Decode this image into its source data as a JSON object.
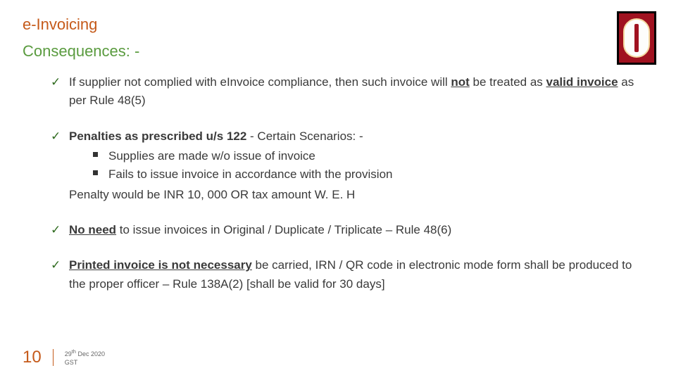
{
  "header": {
    "title": "e-Invoicing",
    "subtitle": "Consequences: -"
  },
  "points": {
    "p1": {
      "pre": "If supplier not complied with eInvoice compliance, then such invoice will ",
      "not": "not",
      "mid": " be treated as ",
      "valid": "valid invoice",
      "post": " as per Rule 48(5)"
    },
    "p2": {
      "lead_bold": "Penalties as prescribed u/s 122",
      "lead_rest": " - Certain Scenarios: -",
      "s1": "Supplies are made w/o issue of invoice",
      "s2": "Fails to issue invoice in accordance with the provision",
      "note": "Penalty would be INR 10, 000 OR tax amount W. E. H"
    },
    "p3": {
      "bold": "No need",
      "rest": " to issue invoices in Original / Duplicate / Triplicate – Rule 48(6)"
    },
    "p4": {
      "bold": "Printed invoice is not necessary",
      "rest": " be carried, IRN / QR code in electronic mode form shall be produced to the proper officer – Rule 138A(2) [shall be valid for 30 days]"
    }
  },
  "footer": {
    "page": "10",
    "date_day": "29",
    "date_sup": "th",
    "date_rest": " Dec 2020",
    "tag": "GST"
  }
}
